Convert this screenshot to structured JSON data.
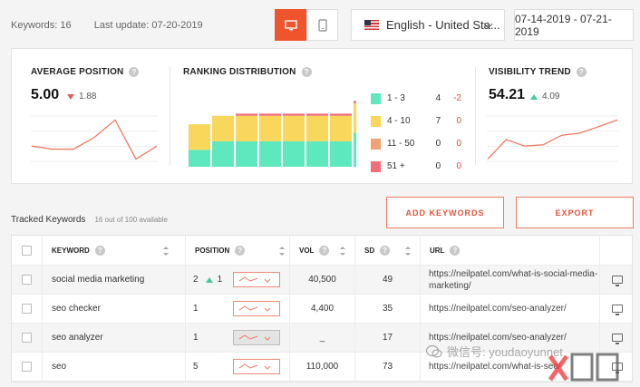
{
  "header": {
    "keywords_count": "Keywords: 16",
    "last_update": "Last update: 07-20-2019",
    "language": "English - United Sta...",
    "date_range": "07-14-2019 - 07-21-2019",
    "desktop_active": true
  },
  "average_position": {
    "title": "AVERAGE POSITION",
    "value": "5.00",
    "delta": "1.88",
    "delta_direction": "down",
    "trend": [
      0.35,
      0.28,
      0.28,
      0.55,
      0.95,
      0.05,
      0.35
    ]
  },
  "ranking_distribution": {
    "title": "RANKING DISTRIBUTION",
    "legend": [
      {
        "label": "1 - 3",
        "count": "4",
        "delta": "-2",
        "color": "#5ee8bd"
      },
      {
        "label": "4 - 10",
        "count": "7",
        "delta": "0",
        "color": "#f9d65c"
      },
      {
        "label": "11 - 50",
        "count": "0",
        "delta": "0",
        "color": "#f1a173"
      },
      {
        "label": "51 +",
        "count": "0",
        "delta": "0",
        "color": "#f06e77"
      }
    ],
    "bars": [
      {
        "g1": 4,
        "g2": 6,
        "g3": 0,
        "g4": 0
      },
      {
        "g1": 6,
        "g2": 6,
        "g3": 0,
        "g4": 0
      },
      {
        "g1": 6,
        "g2": 6,
        "g3": 0,
        "g4": 0.5
      },
      {
        "g1": 6,
        "g2": 6,
        "g3": 0,
        "g4": 0.5
      },
      {
        "g1": 6,
        "g2": 6,
        "g3": 0,
        "g4": 0.5
      },
      {
        "g1": 6,
        "g2": 6,
        "g3": 0,
        "g4": 0.5
      },
      {
        "g1": 6,
        "g2": 6,
        "g3": 0,
        "g4": 0.5
      },
      {
        "g1": 8,
        "g2": 7,
        "g3": 0,
        "g4": 0.5
      }
    ]
  },
  "visibility_trend": {
    "title": "VISIBILITY TREND",
    "value": "54.21",
    "delta": "4.09",
    "delta_direction": "up",
    "trend": [
      0.05,
      0.5,
      0.35,
      0.38,
      0.6,
      0.65,
      0.8,
      0.95
    ]
  },
  "tracked": {
    "label": "Tracked Keywords",
    "available": "16 out of 100 available",
    "add_button": "ADD KEYWORDS",
    "export_button": "EXPORT"
  },
  "table": {
    "headers": {
      "keyword": "KEYWORD",
      "position": "POSITION",
      "vol": "VOL",
      "sd": "SD",
      "url": "URL"
    },
    "rows": [
      {
        "keyword": "social media marketing",
        "position": "2",
        "change": "1",
        "vol": "40,500",
        "sd": "49",
        "url": "https://neilpatel.com/what-is-social-media-marketing/"
      },
      {
        "keyword": "seo checker",
        "position": "1",
        "change": "",
        "vol": "4,400",
        "sd": "35",
        "url": "https://neilpatel.com/seo-analyzer/"
      },
      {
        "keyword": "seo analyzer",
        "position": "1",
        "change": "",
        "vol": "_",
        "sd": "17",
        "url": "https://neilpatel.com/seo-analyzer/"
      },
      {
        "keyword": "seo",
        "position": "5",
        "change": "",
        "vol": "110,000",
        "sd": "73",
        "url": "https://neilpatel.com/what-is-seo/"
      }
    ]
  },
  "watermark": {
    "text": "微信号: youdaoyunnet"
  }
}
